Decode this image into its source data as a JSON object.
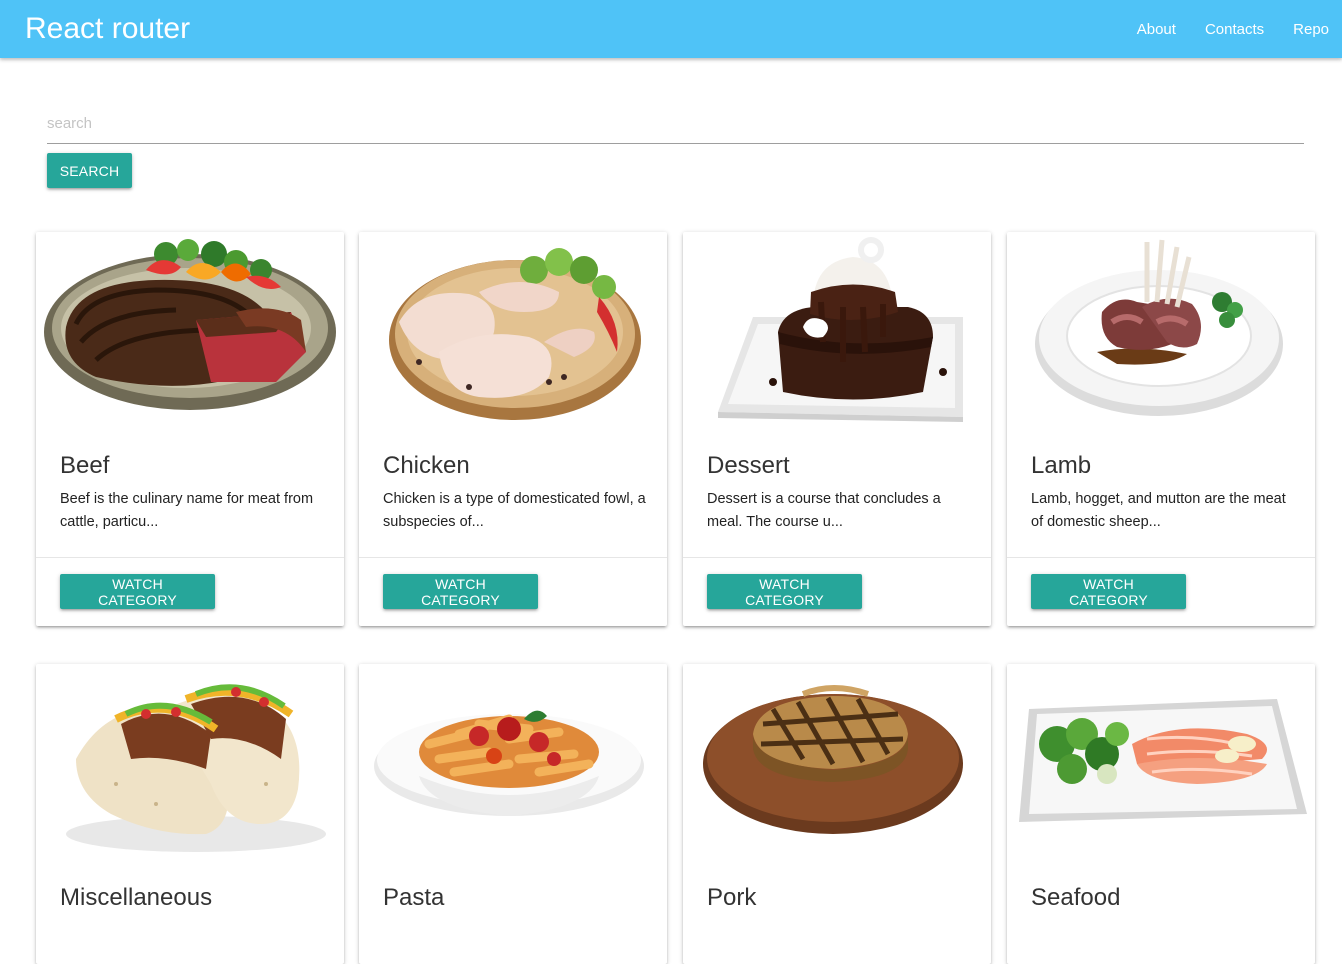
{
  "navbar": {
    "brand": "React router",
    "links": [
      "About",
      "Contacts",
      "Repo"
    ],
    "color": "#4fc3f7"
  },
  "search": {
    "placeholder": "search",
    "value": "",
    "button_label": "Search"
  },
  "accent_color": "#26a69a",
  "categories": [
    {
      "title": "Beef",
      "description": "Beef is the culinary name for meat from cattle, particu...",
      "action": "Watch category",
      "image_icon": "steak-plate-image"
    },
    {
      "title": "Chicken",
      "description": "Chicken is a type of domesticated fowl, a subspecies of...",
      "action": "Watch category",
      "image_icon": "chicken-legs-image"
    },
    {
      "title": "Dessert",
      "description": "Dessert is a course that concludes a meal. The course u...",
      "action": "Watch category",
      "image_icon": "chocolate-cake-image"
    },
    {
      "title": "Lamb",
      "description": "Lamb, hogget, and mutton are the meat of domestic sheep...",
      "action": "Watch category",
      "image_icon": "lamb-rack-image"
    },
    {
      "title": "Miscellaneous",
      "image_icon": "tacos-image"
    },
    {
      "title": "Pasta",
      "image_icon": "pasta-bowl-image"
    },
    {
      "title": "Pork",
      "image_icon": "pork-chop-board-image"
    },
    {
      "title": "Seafood",
      "image_icon": "salmon-platter-image"
    }
  ]
}
